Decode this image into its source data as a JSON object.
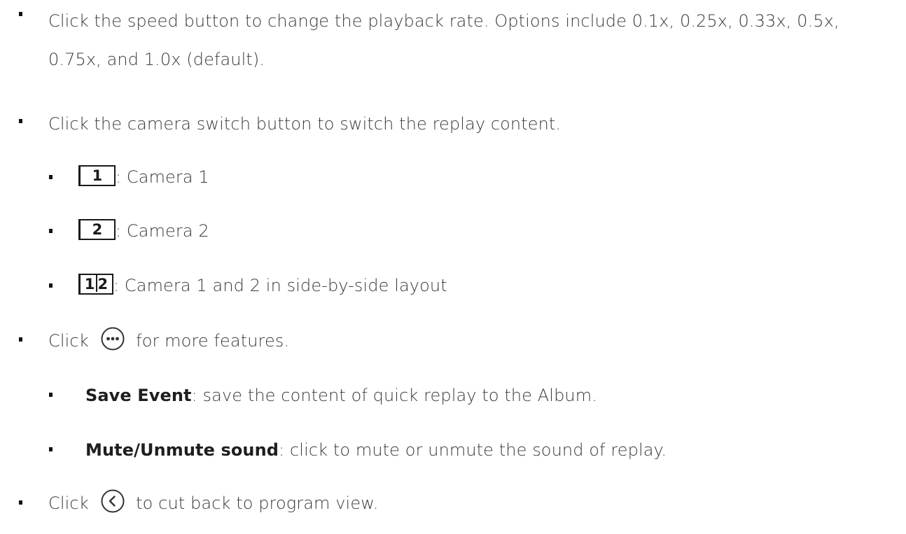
{
  "items": [
    {
      "text": "Click the speed button to change the playback rate. Options include 0.1x, 0.25x, 0.33x, 0.5x, 0.75x, and 1.0x (default)."
    },
    {
      "text": "Click the camera switch button to switch the replay content."
    }
  ],
  "camera_options": [
    {
      "key": "1",
      "label": ": Camera 1"
    },
    {
      "key": "2",
      "label": ": Camera 2"
    },
    {
      "key_left": "1",
      "key_right": "2",
      "label": ": Camera 1 and 2 in side-by-side layout"
    }
  ],
  "more": {
    "prefix": "Click",
    "icon": "more-horizontal-circle-icon",
    "suffix": "for more features."
  },
  "features": [
    {
      "term": "Save Event",
      "desc": ": save the content of quick replay to the Album."
    },
    {
      "term": "Mute/Unmute sound",
      "desc": ": click to mute or unmute the sound of replay."
    }
  ],
  "back": {
    "prefix": "Click",
    "icon": "back-chevron-circle-icon",
    "suffix": "to cut back to program view."
  },
  "colors": {
    "text": "#3a3a3a",
    "bullet": "#111111",
    "icon": "#333333"
  }
}
